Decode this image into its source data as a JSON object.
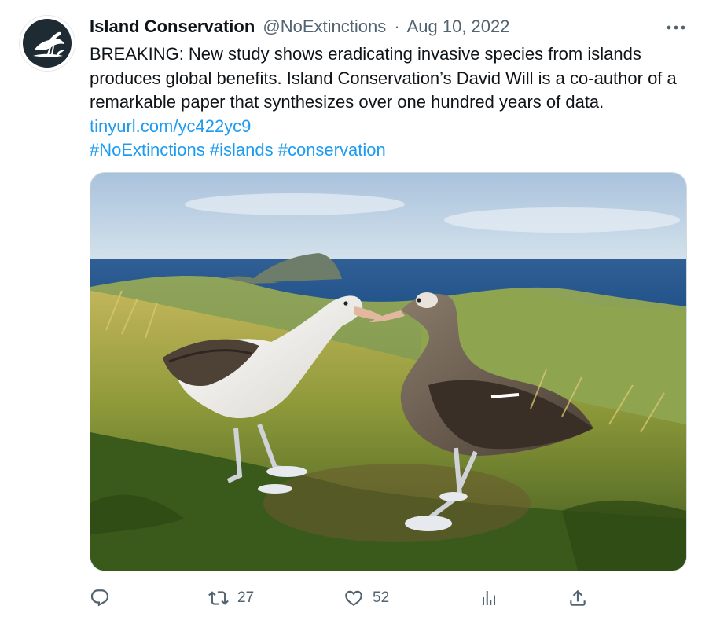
{
  "tweet": {
    "author_name": "Island Conservation",
    "handle": "@NoExtinctions",
    "separator": "·",
    "date": "Aug 10, 2022",
    "more_icon": "ellipsis-icon",
    "text": "BREAKING: New study shows eradicating invasive species from islands produces global benefits. Island Conservation’s David Will is a co-author of a remarkable paper that synthesizes over one hundred years of data.",
    "link": "tinyurl.com/yc422yc9",
    "hashtags": [
      "#NoExtinctions",
      "#islands",
      "#conservation"
    ]
  },
  "actions": {
    "reply": {
      "icon": "reply-icon",
      "count": ""
    },
    "retweet": {
      "icon": "retweet-icon",
      "count": "27"
    },
    "like": {
      "icon": "heart-icon",
      "count": "52"
    },
    "views": {
      "icon": "analytics-icon",
      "count": ""
    },
    "share": {
      "icon": "share-icon",
      "count": ""
    }
  },
  "colors": {
    "accent": "#1d9bf0",
    "secondary_text": "#536471",
    "primary_text": "#0f1419",
    "avatar_bg": "#1e2b33"
  }
}
